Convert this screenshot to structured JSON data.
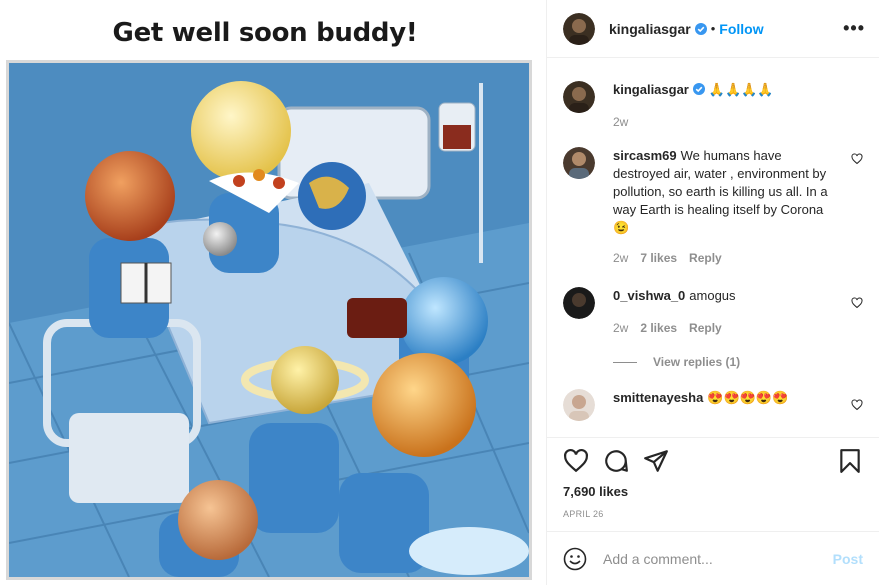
{
  "media": {
    "caption_title": "Get well soon buddy!"
  },
  "header": {
    "username": "kingaliasgar",
    "separator": "•",
    "follow_label": "Follow",
    "more_label": "•••",
    "verified_icon": "verified-badge-icon"
  },
  "comments": [
    {
      "username": "kingaliasgar",
      "text": "🙏🙏🙏🙏",
      "age": "2w",
      "verified": true,
      "avatar_color": "#3b2f22"
    },
    {
      "username": "sircasm69",
      "text": "We humans have destroyed air, water , environment by pollution, so earth is killing us all. In a way Earth is healing itself by Corona😉",
      "age": "2w",
      "likes": "7 likes",
      "reply_label": "Reply",
      "avatar_color": "#4a3a2e"
    },
    {
      "username": "0_vishwa_0",
      "text": "amogus",
      "age": "2w",
      "likes": "2 likes",
      "reply_label": "Reply",
      "view_replies": "View replies (1)",
      "avatar_color": "#1a1a1a"
    },
    {
      "username": "smittenayesha",
      "text": "😍😍😍😍😍",
      "avatar_color": "#c8b6a8"
    }
  ],
  "actions": {
    "likes": "7,690 likes",
    "date": "APRIL 26",
    "icons": [
      "heart-icon",
      "comment-icon",
      "share-icon",
      "bookmark-icon"
    ]
  },
  "add_comment": {
    "placeholder": "Add a comment...",
    "post_label": "Post"
  },
  "colors": {
    "accent": "#0095f6",
    "post_disabled": "#b2dffc",
    "muted": "#8e8e8e",
    "border": "#efefef"
  }
}
